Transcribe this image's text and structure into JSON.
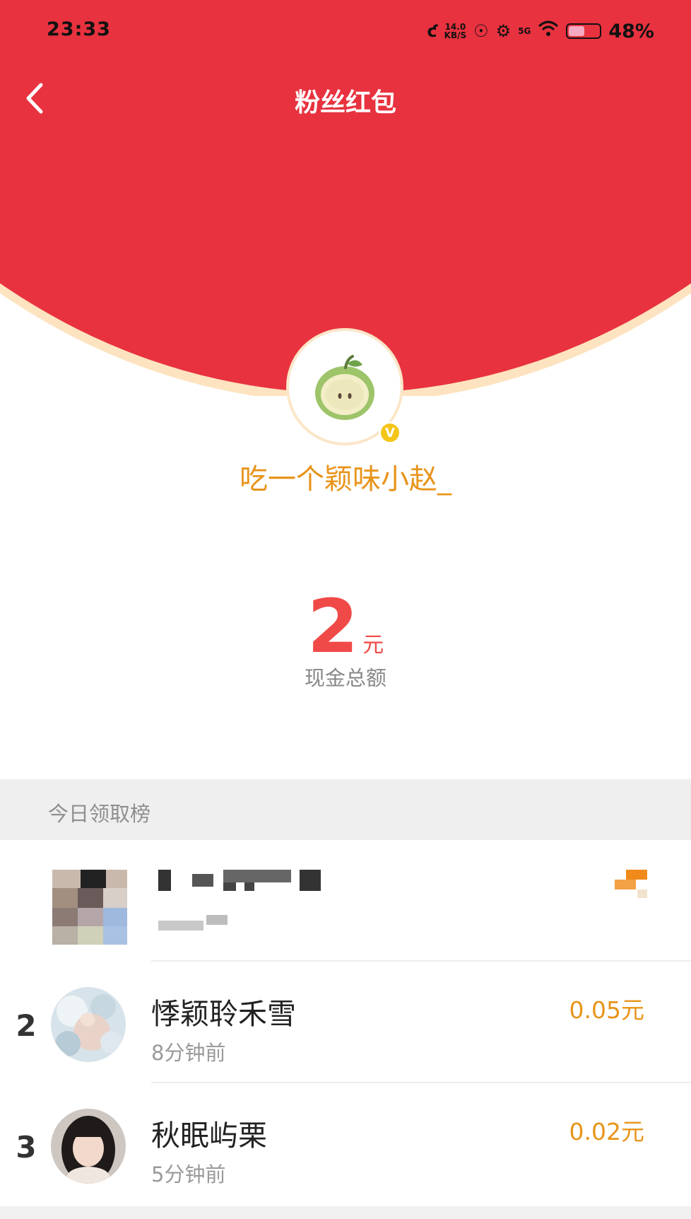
{
  "status_bar": {
    "time": "23:33",
    "speed_value": "14.0",
    "speed_unit": "KB/S",
    "network": "5G",
    "battery": "48%"
  },
  "header": {
    "title": "粉丝红包",
    "back_icon": "chevron-left-icon"
  },
  "anchor": {
    "name": "吃一个颖味小赵_",
    "verified_badge": "V",
    "avatar_icon": "apple-avatar-icon"
  },
  "packet": {
    "amount": "2",
    "unit": "元",
    "label": "现金总额"
  },
  "leaderboard": {
    "title": "今日领取榜",
    "rows": [
      {
        "rank": "2",
        "name": "悸颖聆禾雪",
        "time": "8分钟前",
        "amount": "0.05元"
      },
      {
        "rank": "3",
        "name": "秋眠屿栗",
        "time": "5分钟前",
        "amount": "0.02元"
      }
    ]
  },
  "colors": {
    "hero_red": "#e8323f",
    "accent_orange": "#e8941b",
    "amount_red": "#f04a48"
  }
}
